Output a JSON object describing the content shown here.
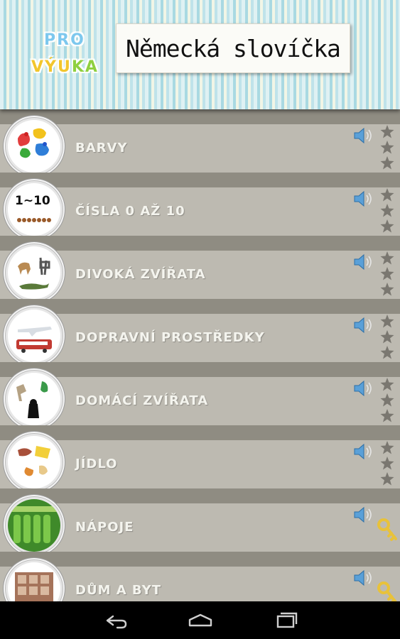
{
  "app": {
    "logo_line1": [
      "PRO",
      ""
    ],
    "logo_line2": [
      "VÝU",
      "KA"
    ],
    "title": "Německá slovíčka"
  },
  "categories": [
    {
      "label": "BARVY",
      "thumb": "colors-paint-splash",
      "indicator": "stars",
      "thumb_text": ""
    },
    {
      "label": "ČÍSLA 0 AŽ 10",
      "thumb": "numbers",
      "indicator": "stars",
      "thumb_text": "1~10"
    },
    {
      "label": "DIVOKÁ ZVÍŘATA",
      "thumb": "wild-animals",
      "indicator": "stars",
      "thumb_text": ""
    },
    {
      "label": "DOPRAVNÍ PROSTŘEDKY",
      "thumb": "vehicles",
      "indicator": "stars",
      "thumb_text": ""
    },
    {
      "label": "DOMÁCÍ ZVÍŘATA",
      "thumb": "pets",
      "indicator": "stars",
      "thumb_text": ""
    },
    {
      "label": "JÍDLO",
      "thumb": "food",
      "indicator": "stars",
      "thumb_text": ""
    },
    {
      "label": "NÁPOJE",
      "thumb": "drinks",
      "indicator": "key",
      "thumb_text": ""
    },
    {
      "label": "DŮM A BYT",
      "thumb": "house",
      "indicator": "key",
      "thumb_text": ""
    }
  ],
  "colors": {
    "background": "#8f8c82",
    "row": "#bdbab1",
    "label": "#f4f4ee",
    "speaker": "#5aa0d8",
    "star": "#7a7770",
    "key": "#e8c23a"
  },
  "navbar": {
    "icons": [
      "back-icon",
      "home-icon",
      "recent-apps-icon"
    ]
  }
}
